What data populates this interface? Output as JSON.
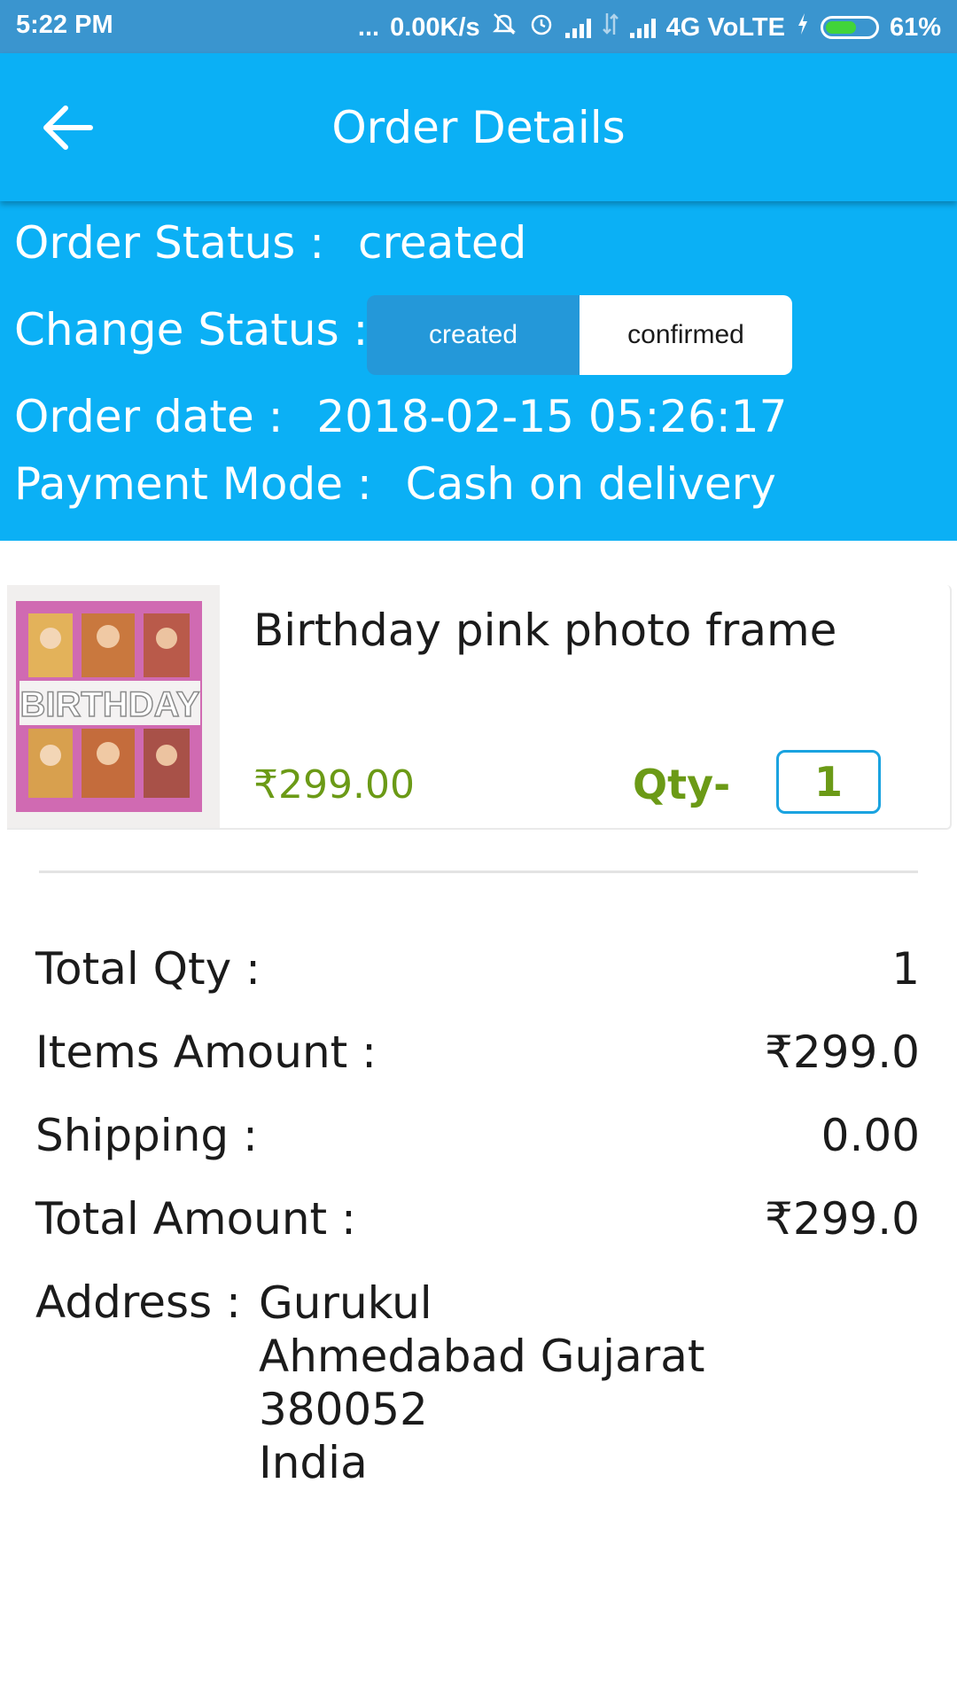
{
  "status_bar": {
    "time": "5:22 PM",
    "dots": "...",
    "speed": "0.00K/s",
    "network": "4G VoLTE",
    "battery": "61%"
  },
  "app_bar": {
    "title": "Order Details"
  },
  "order": {
    "status_label": "Order Status :",
    "status_value": "created",
    "change_status_label": "Change Status :",
    "status_options": [
      "created",
      "confirmed"
    ],
    "selected_status": "created",
    "date_label": "Order date :",
    "date_value": "2018-02-15 05:26:17",
    "payment_label": "Payment Mode :",
    "payment_value": "Cash on delivery"
  },
  "product": {
    "name": "Birthday pink photo frame",
    "price": "₹299.00",
    "qty_label": "Qty-",
    "qty_value": "1",
    "image_text": "BIRTHDAY"
  },
  "summary": {
    "total_qty_label": "Total Qty :",
    "total_qty_value": "1",
    "items_amount_label": "Items Amount :",
    "items_amount_value": "₹299.0",
    "shipping_label": "Shipping :",
    "shipping_value": "0.00",
    "total_amount_label": "Total Amount :",
    "total_amount_value": "₹299.0"
  },
  "address": {
    "label": "Address :",
    "lines": [
      "Gurukul",
      "Ahmedabad Gujarat",
      "380052",
      "India"
    ]
  },
  "colors": {
    "primary": "#0bb0f5",
    "status_bar": "#3a95cf",
    "price_green": "#6b9a16",
    "segment_selected": "#2498d9"
  }
}
